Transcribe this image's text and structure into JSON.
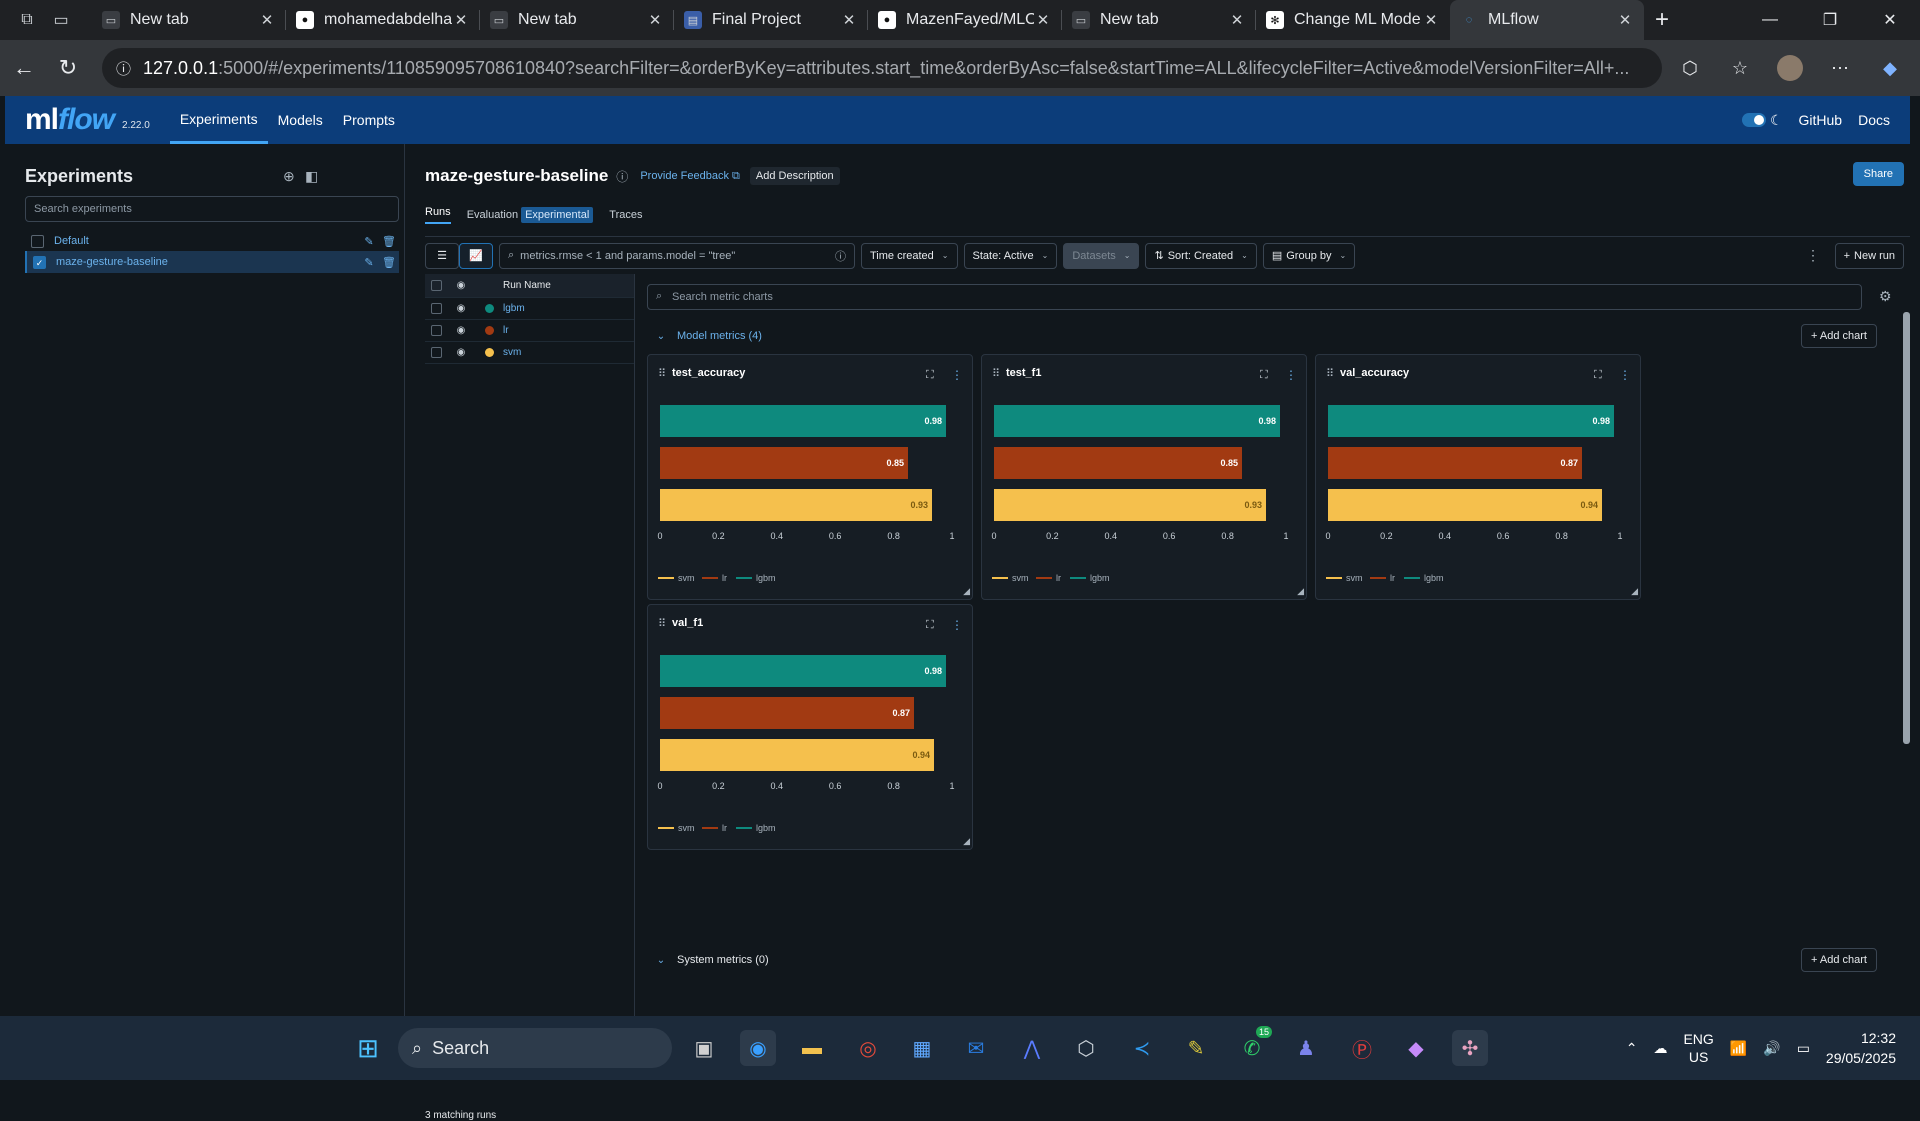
{
  "browser": {
    "tabs": [
      {
        "title": "New tab",
        "icon": "newtab-icon"
      },
      {
        "title": "mohamedabdelha",
        "icon": "github-icon"
      },
      {
        "title": "New tab",
        "icon": "newtab-icon"
      },
      {
        "title": "Final Project",
        "icon": "doc-icon"
      },
      {
        "title": "MazenFayed/MLO",
        "icon": "github-icon"
      },
      {
        "title": "New tab",
        "icon": "newtab-icon"
      },
      {
        "title": "Change ML Mode",
        "icon": "openai-icon"
      },
      {
        "title": "MLflow",
        "icon": "mlflow-icon"
      }
    ],
    "url_host": "127.0.0.1",
    "url_path": ":5000/#/experiments/110859095708610840?searchFilter=&orderByKey=attributes.start_time&orderByAsc=false&startTime=ALL&lifecycleFilter=Active&modelVersionFilter=All+..."
  },
  "header": {
    "logo_ml": "ml",
    "logo_flow": "flow",
    "version": "2.22.0",
    "nav": [
      "Experiments",
      "Models",
      "Prompts"
    ],
    "github": "GitHub",
    "docs": "Docs"
  },
  "sidebar": {
    "title": "Experiments",
    "search_placeholder": "Search experiments",
    "experiments": [
      {
        "name": "Default",
        "selected": false
      },
      {
        "name": "maze-gesture-baseline",
        "selected": true
      }
    ]
  },
  "page": {
    "title": "maze-gesture-baseline",
    "feedback": "Provide Feedback",
    "add_description": "Add Description",
    "share": "Share",
    "tabs": {
      "runs": "Runs",
      "evaluation": "Evaluation",
      "experimental": "Experimental",
      "traces": "Traces"
    }
  },
  "toolbar": {
    "filter_placeholder": "metrics.rmse < 1 and params.model = \"tree\"",
    "time_created": "Time created",
    "state": "State: Active",
    "datasets": "Datasets",
    "sort": "Sort: Created",
    "group_by": "Group by",
    "new_run": "New run"
  },
  "runs": {
    "header": "Run Name",
    "rows": [
      {
        "name": "lgbm",
        "color": "#0e8a7e"
      },
      {
        "name": "lr",
        "color": "#a23a12"
      },
      {
        "name": "svm",
        "color": "#f5c04d"
      }
    ],
    "matching": "3 matching runs"
  },
  "charts": {
    "search_placeholder": "Search metric charts",
    "section_model": "Model metrics (4)",
    "section_system": "System metrics (0)",
    "add_chart": "Add chart",
    "ticks": [
      "0",
      "0.2",
      "0.4",
      "0.6",
      "0.8",
      "1"
    ],
    "legend": [
      "svm",
      "lr",
      "lgbm"
    ]
  },
  "chart_data": [
    {
      "type": "bar",
      "title": "test_accuracy",
      "categories": [
        "lgbm",
        "lr",
        "svm"
      ],
      "values": [
        0.98,
        0.85,
        0.93
      ],
      "xlim": [
        0,
        1
      ]
    },
    {
      "type": "bar",
      "title": "test_f1",
      "categories": [
        "lgbm",
        "lr",
        "svm"
      ],
      "values": [
        0.98,
        0.85,
        0.93
      ],
      "xlim": [
        0,
        1
      ]
    },
    {
      "type": "bar",
      "title": "val_accuracy",
      "categories": [
        "lgbm",
        "lr",
        "svm"
      ],
      "values": [
        0.98,
        0.87,
        0.94
      ],
      "xlim": [
        0,
        1
      ]
    },
    {
      "type": "bar",
      "title": "val_f1",
      "categories": [
        "lgbm",
        "lr",
        "svm"
      ],
      "values": [
        0.98,
        0.87,
        0.94
      ],
      "xlim": [
        0,
        1
      ]
    }
  ],
  "taskbar": {
    "search": "Search",
    "lang1": "ENG",
    "lang2": "US",
    "time": "12:32",
    "date": "29/05/2025",
    "badge": "15"
  }
}
